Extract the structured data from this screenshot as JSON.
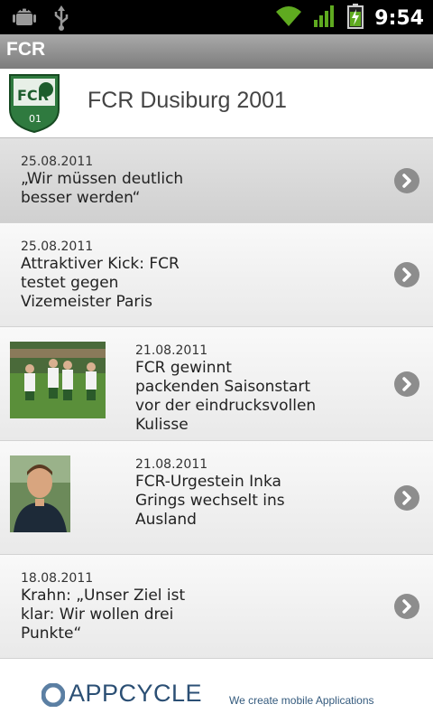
{
  "statusbar": {
    "time": "9:54"
  },
  "app": {
    "title": "FCR"
  },
  "header": {
    "club_name": "FCR Dusiburg 2001",
    "crest_letters": "FCR",
    "crest_number": "01"
  },
  "news": [
    {
      "date": "25.08.2011",
      "title": "„Wir müssen deutlich besser werden“"
    },
    {
      "date": "25.08.2011",
      "title": "Attraktiver Kick: FCR testet gegen Vizemeister Paris"
    },
    {
      "date": "21.08.2011",
      "title": "FCR gewinnt packenden Saisonstart vor der eindrucksvollen Kulisse"
    },
    {
      "date": "21.08.2011",
      "title": "FCR-Urgestein Inka Grings wechselt ins Ausland"
    },
    {
      "date": "18.08.2011",
      "title": "Krahn: „Unser Ziel ist klar: Wir wollen drei Punkte“"
    }
  ],
  "footer": {
    "brand": "APPCYCLE",
    "tagline": "We create mobile Applications"
  }
}
